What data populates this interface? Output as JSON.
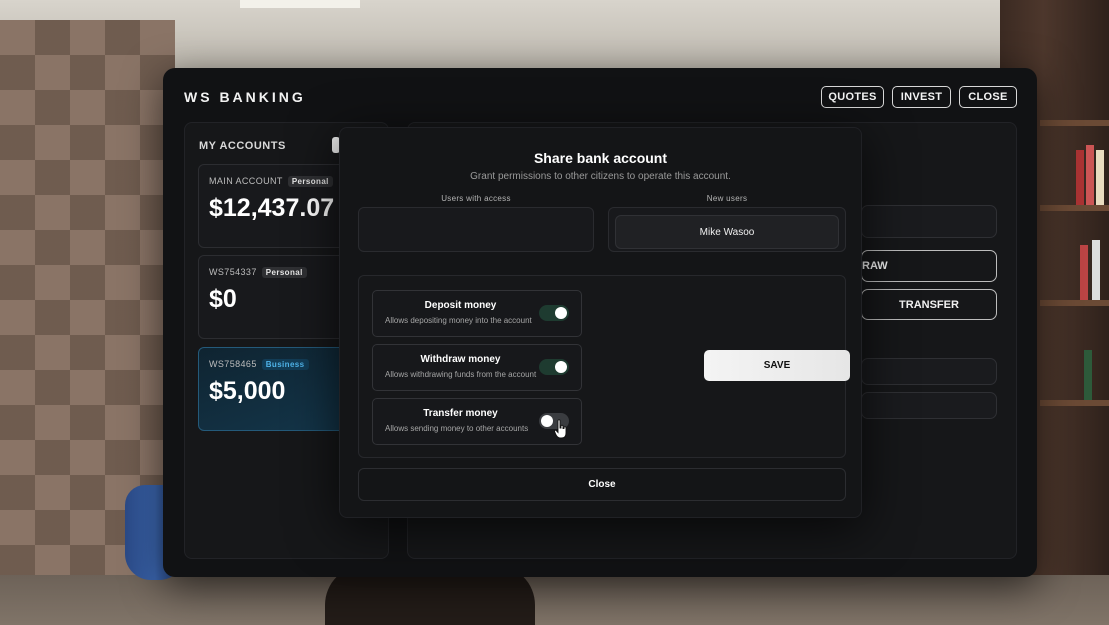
{
  "app": {
    "title": "WS BANKING",
    "header_buttons": {
      "quotes": "QUOTES",
      "invest": "INVEST",
      "close": "CLOSE"
    }
  },
  "sidebar": {
    "title": "MY ACCOUNTS",
    "accounts": [
      {
        "id": "MAIN ACCOUNT",
        "type": "Personal",
        "balance": "$12,437.07",
        "active": false
      },
      {
        "id": "WS754337",
        "type": "Personal",
        "balance": "$0",
        "active": false
      },
      {
        "id": "WS758465",
        "type": "Business",
        "balance": "$5,000",
        "active": true
      }
    ]
  },
  "main_panel": {
    "withdraw_label": "RAW",
    "transfer_label": "TRANSFER"
  },
  "modal": {
    "title": "Share bank account",
    "subtitle": "Grant permissions to other citizens to operate this account.",
    "users_with_access_label": "Users with access",
    "new_users_label": "New users",
    "new_users": [
      "Mike Wasoo"
    ],
    "permissions": [
      {
        "name": "Deposit money",
        "description": "Allows depositing money into the account",
        "enabled": true
      },
      {
        "name": "Withdraw money",
        "description": "Allows withdrawing funds from the account",
        "enabled": true
      },
      {
        "name": "Transfer money",
        "description": "Allows sending money to other accounts",
        "enabled": false
      }
    ],
    "save_label": "SAVE",
    "close_label": "Close"
  },
  "colors": {
    "background": "#111214",
    "business_accent": "#4fb4ea",
    "toggle_on": "#1e3b30"
  },
  "icons": [
    "toggle-icon",
    "hand-pointer-icon"
  ]
}
